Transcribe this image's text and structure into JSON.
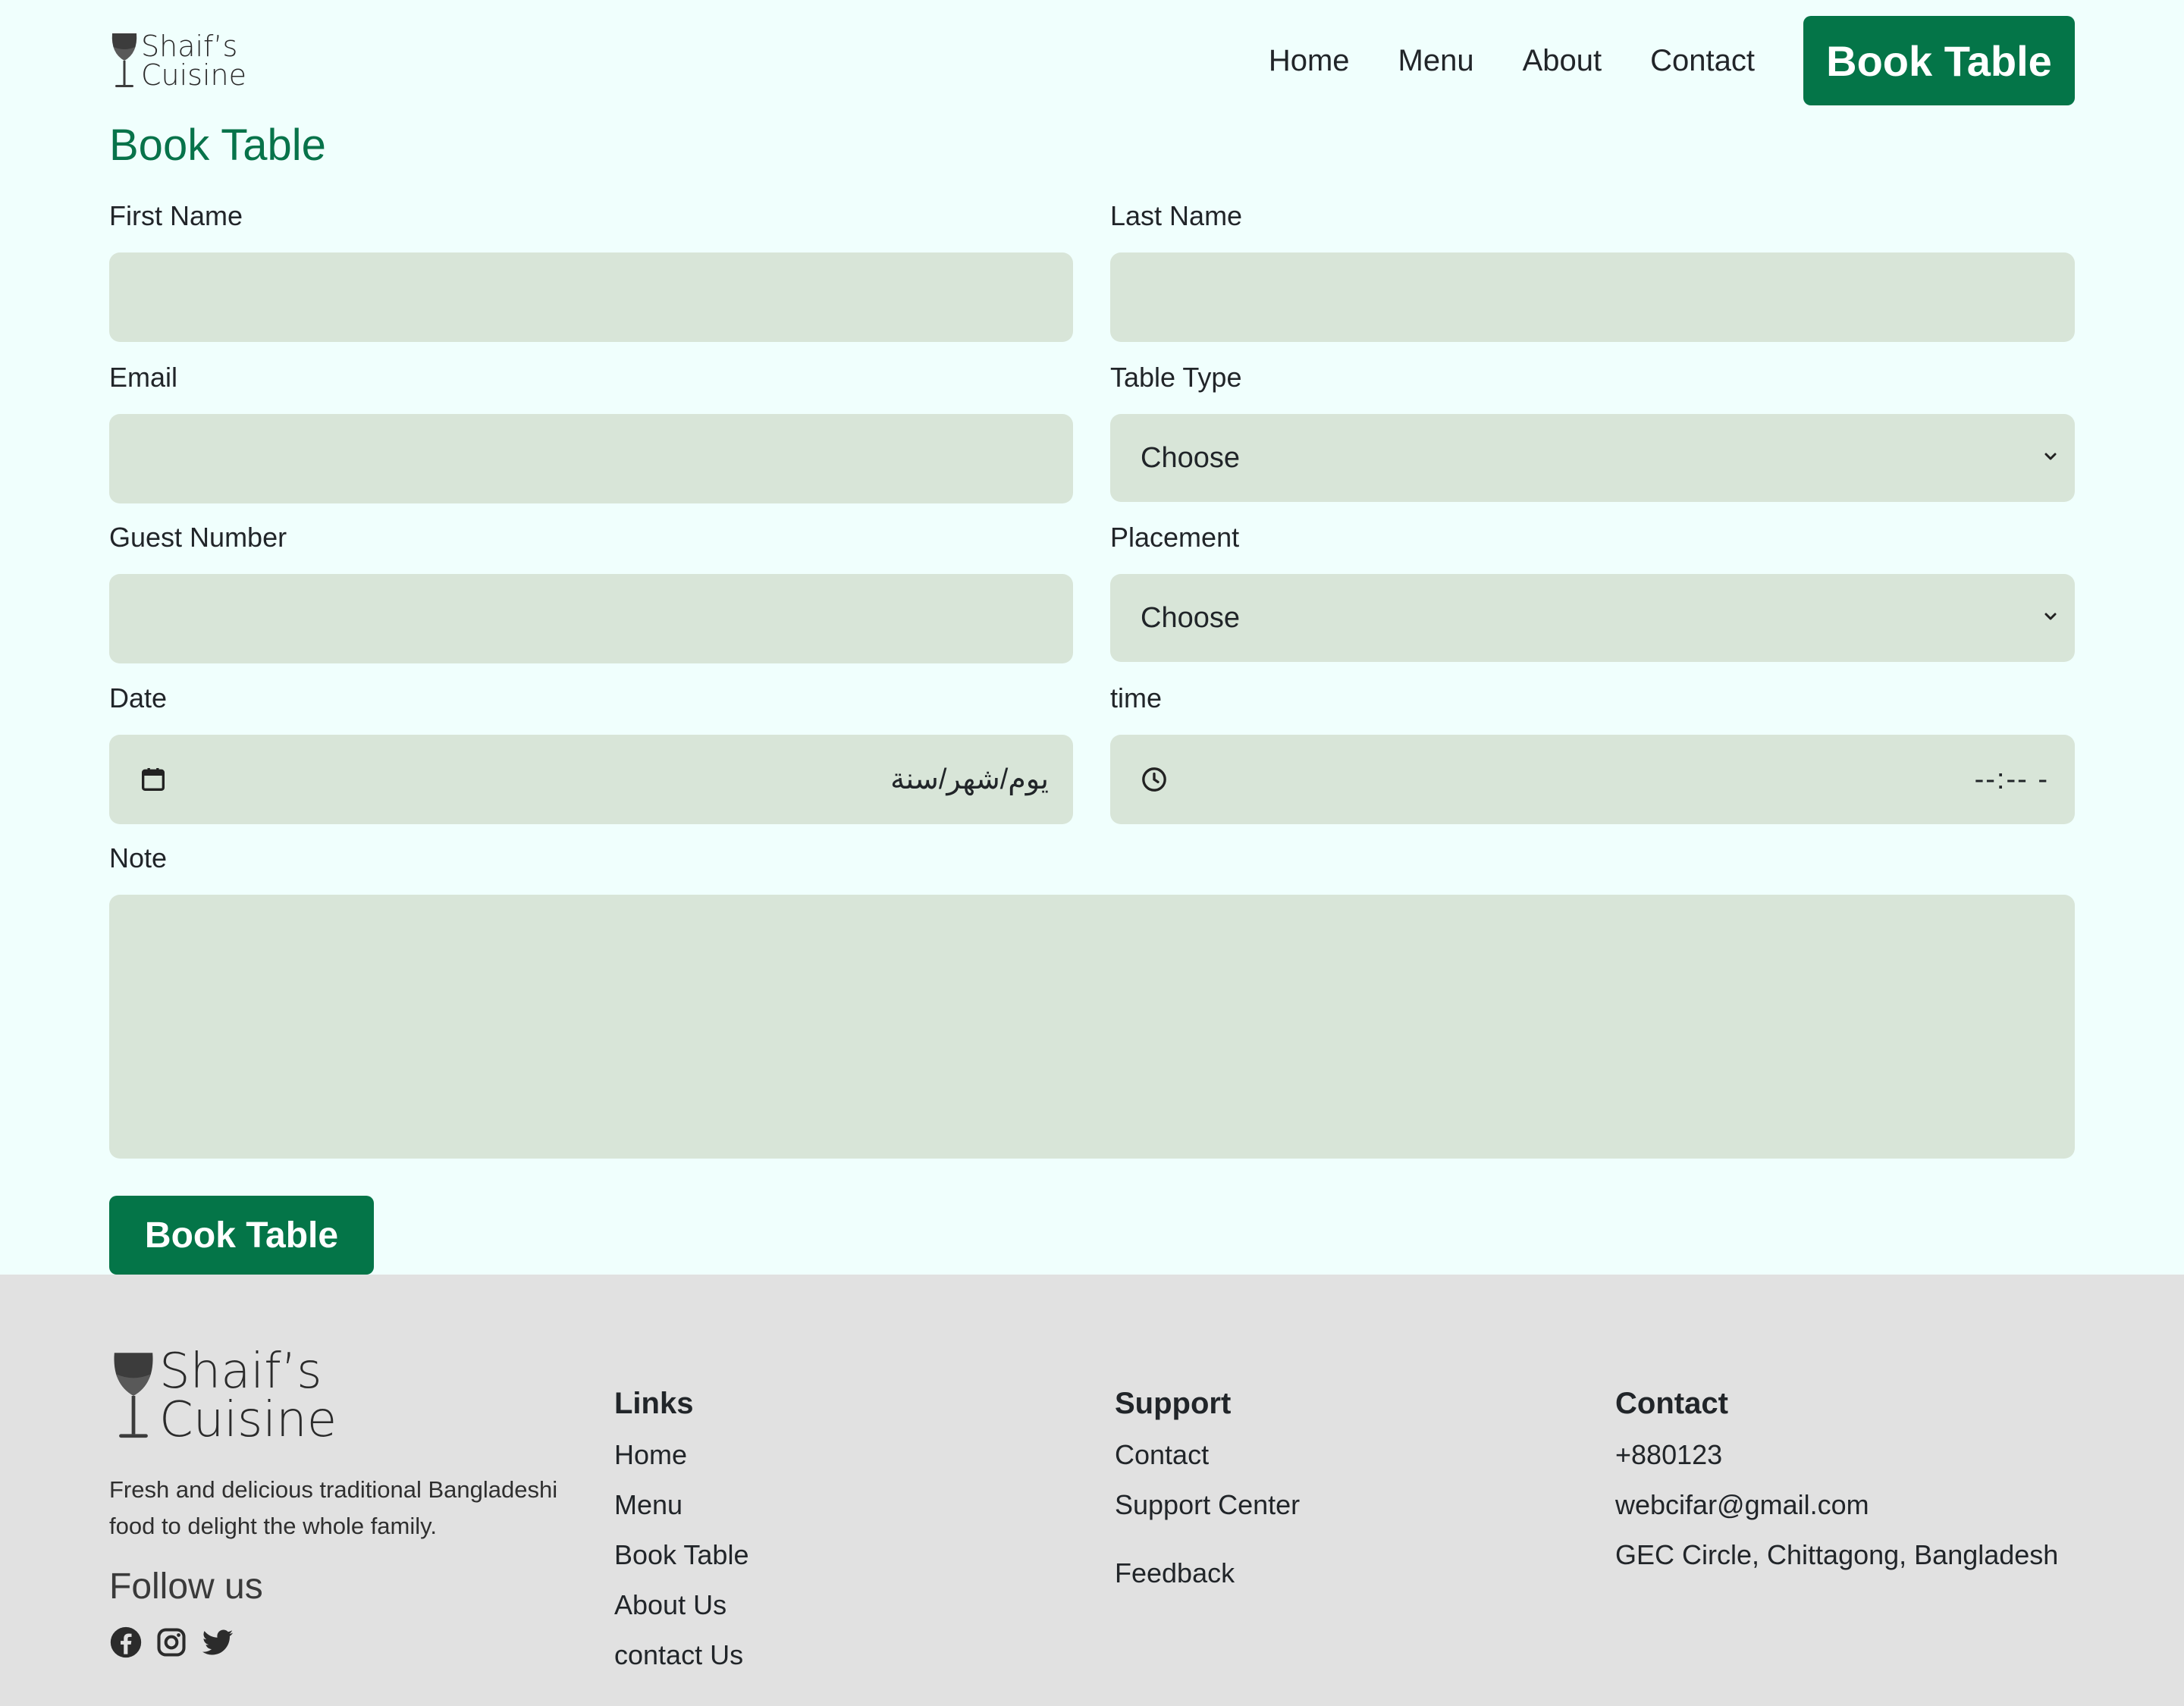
{
  "brand": {
    "line1": "Shaif’s",
    "line2": "Cuisine"
  },
  "nav": {
    "items": [
      "Home",
      "Menu",
      "About",
      "Contact"
    ],
    "cta": "Book Table"
  },
  "form": {
    "title": "Book Table",
    "first_name_label": "First Name",
    "last_name_label": "Last Name",
    "email_label": "Email",
    "table_type_label": "Table Type",
    "table_type_value": "Choose",
    "guest_label": "Guest Number",
    "placement_label": "Placement",
    "placement_value": "Choose",
    "date_label": "Date",
    "date_placeholder": "يوم/شهر/سنة",
    "time_label": "time",
    "time_placeholder": "--:-- -",
    "note_label": "Note",
    "submit": "Book Table"
  },
  "footer": {
    "description": "Fresh and delicious traditional Bangladeshi food to delight the whole family.",
    "follow_title": "Follow us",
    "socials": [
      "facebook-icon",
      "instagram-icon",
      "twitter-icon"
    ],
    "links": {
      "title": "Links",
      "items": [
        "Home",
        "Menu",
        "Book Table",
        "About Us",
        "contact Us"
      ]
    },
    "support": {
      "title": "Support",
      "items": [
        "Contact",
        "Support Center",
        "Feedback"
      ]
    },
    "contact": {
      "title": "Contact",
      "phone": "+880123",
      "email": "webcifar@gmail.com",
      "address": "GEC Circle, Chittagong, Bangladesh"
    }
  },
  "colors": {
    "primary": "#047548",
    "title": "#07734a",
    "input_bg": "#d8e5d8",
    "page_bg": "#f0fffd",
    "footer_bg": "#e1e1e1"
  }
}
